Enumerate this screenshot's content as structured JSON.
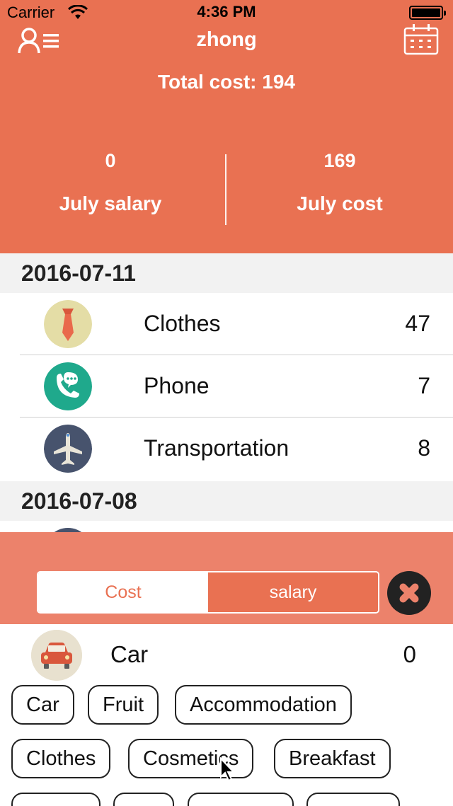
{
  "status_bar": {
    "carrier": "Carrier",
    "time": "4:36 PM"
  },
  "header": {
    "title": "zhong",
    "total": "Total cost: 194",
    "left_value": "0",
    "left_label": "July salary",
    "right_value": "169",
    "right_label": "July cost"
  },
  "list": {
    "groups": [
      {
        "date": "2016-07-11",
        "items": [
          {
            "name": "Clothes",
            "amount": "47",
            "icon": "tie-icon"
          },
          {
            "name": "Phone",
            "amount": "7",
            "icon": "phone-icon"
          },
          {
            "name": "Transportation",
            "amount": "8",
            "icon": "airplane-icon"
          }
        ]
      },
      {
        "date": "2016-07-08"
      }
    ]
  },
  "panel": {
    "tabs": {
      "cost": "Cost",
      "salary": "salary"
    },
    "selected": {
      "name": "Car",
      "amount": "0",
      "icon": "car-icon"
    },
    "categories": [
      "Car",
      "Fruit",
      "Accommodation",
      "Clothes",
      "Cosmetics",
      "Breakfast"
    ]
  },
  "colors": {
    "accent": "#e97152",
    "panel": "#ec826b"
  }
}
